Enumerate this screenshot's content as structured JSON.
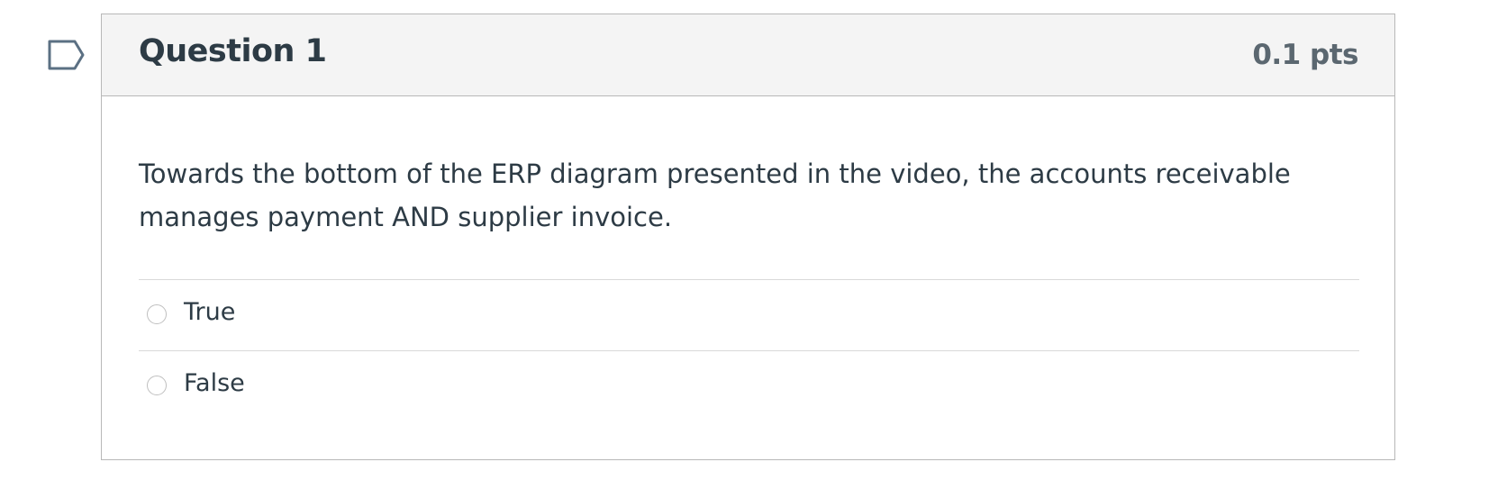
{
  "flag": {
    "icon": "flag-outline-icon",
    "color": "#5b7083"
  },
  "question": {
    "title": "Question 1",
    "points": "0.1 pts",
    "text": "Towards the bottom of the ERP diagram presented in the video, the accounts receivable manages payment AND supplier invoice.",
    "answers": [
      {
        "label": "True",
        "selected": false
      },
      {
        "label": "False",
        "selected": false
      }
    ]
  },
  "colors": {
    "text": "#2d3b45",
    "points": "#5b6770",
    "header_bg": "#f4f4f4",
    "border": "#b8b8b8"
  }
}
